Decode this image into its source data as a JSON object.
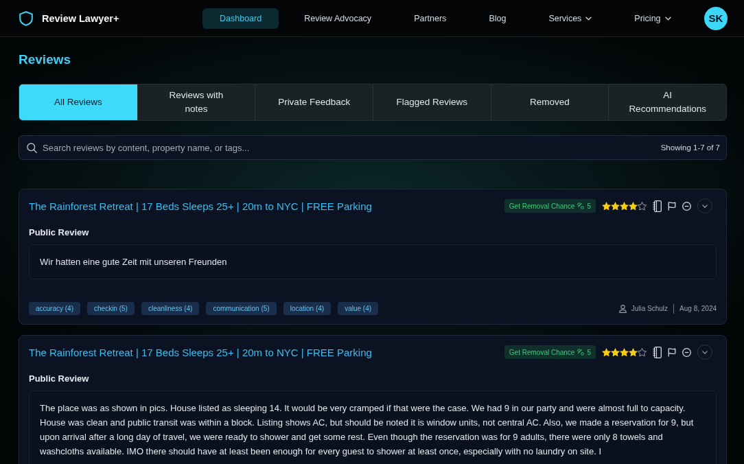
{
  "header": {
    "brand": "Review Lawyer+",
    "nav": [
      {
        "label": "Dashboard",
        "selected": true,
        "dropdown": false
      },
      {
        "label": "Review Advocacy",
        "selected": false,
        "dropdown": false
      },
      {
        "label": "Partners",
        "selected": false,
        "dropdown": false
      },
      {
        "label": "Blog",
        "selected": false,
        "dropdown": false
      },
      {
        "label": "Services",
        "selected": false,
        "dropdown": true
      },
      {
        "label": "Pricing",
        "selected": false,
        "dropdown": true
      }
    ],
    "avatar": "SK"
  },
  "page_title": "Reviews",
  "tabs": [
    {
      "label": "All Reviews",
      "selected": true
    },
    {
      "label": "Reviews with notes",
      "selected": false
    },
    {
      "label": "Private Feedback",
      "selected": false
    },
    {
      "label": "Flagged Reviews",
      "selected": false
    },
    {
      "label": "Removed",
      "selected": false
    },
    {
      "label": "AI Recommendations",
      "selected": false
    }
  ],
  "search": {
    "placeholder": "Search reviews by content, property name, or tags...",
    "result_count": "Showing 1-7 of 7"
  },
  "reviews": [
    {
      "property": "The Rainforest Retreat | 17 Beds Sleeps 25+ | 20m to NYC | FREE Parking",
      "removal_label": "Get Removal Chance",
      "removal_score": "5",
      "stars": 4,
      "section": "Public Review",
      "text": "Wir hatten eine gute Zeit mit unseren Freunden",
      "tags": [
        "accuracy (4)",
        "checkin (5)",
        "cleanliness (4)",
        "communication (5)",
        "location (4)",
        "value (4)"
      ],
      "author": "Julia Schulz",
      "date": "Aug 8, 2024"
    },
    {
      "property": "The Rainforest Retreat | 17 Beds Sleeps 25+ | 20m to NYC | FREE Parking",
      "removal_label": "Get Removal Chance",
      "removal_score": "5",
      "stars": 4,
      "section": "Public Review",
      "text": "The place was as shown in pics. House listed as sleeping 14. It would be very cramped if that were the case. We had 9 in our party and were almost full to capacity. House was clean and public transit was within a block. Listing shows AC, but should be noted it is window units, not central AC. Also, we made a reservation for 9, but upon arrival after a long day of travel, we were ready to shower and get some rest. Even though the reservation was for 9 adults, there were only 8 towels and washcloths available. IMO there should have at least been enough for every guest to shower at least once, especially with no laundry on site. I"
    }
  ]
}
